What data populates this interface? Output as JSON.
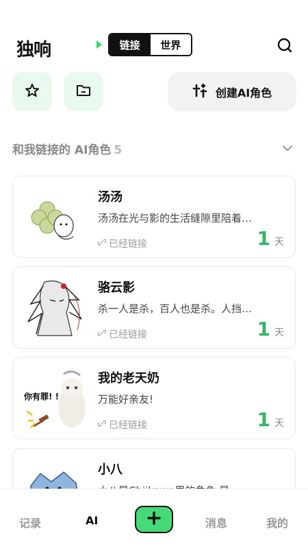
{
  "header": {
    "logo": [
      "独",
      "响"
    ],
    "tabs": [
      {
        "label": "链接",
        "active": true
      },
      {
        "label": "世界",
        "active": false
      }
    ],
    "search_icon": "search-icon"
  },
  "actions": {
    "favorites_icon": "star-icon",
    "folder_icon": "folder-icon",
    "create_label": "创建AI角色",
    "create_icon": "sparkle-icon"
  },
  "section": {
    "title": "和我链接的 AI角色",
    "count": "5"
  },
  "characters": [
    {
      "name": "汤汤",
      "desc": "汤汤在光与影的生活缝隙里陪着…",
      "status": "已经链接",
      "days": "1",
      "unit": "天"
    },
    {
      "name": "骆云影",
      "desc": "杀一人是杀，百人也是杀。人挡…",
      "status": "已经链接",
      "days": "1",
      "unit": "天"
    },
    {
      "name": "我的老天奶",
      "desc": "万能好亲友!",
      "status": "已经链接",
      "days": "1",
      "unit": "天",
      "avatar_text": "你有罪! !"
    },
    {
      "name": "小八",
      "desc": "小八是Chiikawa里的角色,是一…",
      "status": "",
      "days": "",
      "unit": ""
    }
  ],
  "nav": {
    "items": [
      {
        "label": "记录",
        "active": false
      },
      {
        "label": "AI",
        "active": true
      },
      {
        "label": "消息",
        "active": false
      },
      {
        "label": "我的",
        "active": false
      }
    ],
    "plus_icon": "plus-icon"
  },
  "colors": {
    "accent": "#45d978",
    "days": "#37b46a",
    "quick_bg": "#eaf9ee"
  }
}
